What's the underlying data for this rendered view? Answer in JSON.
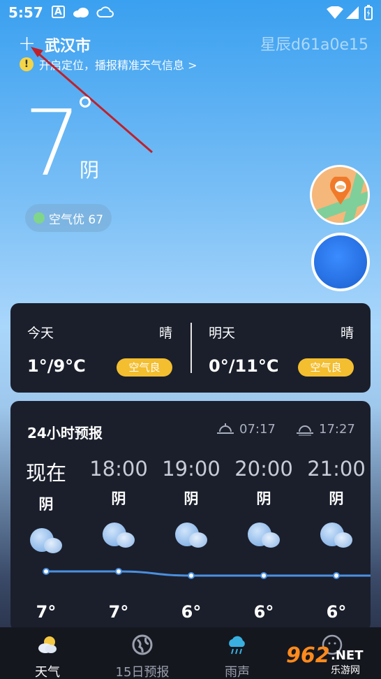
{
  "status": {
    "time": "5:57",
    "icons": [
      "a-notification-icon",
      "cloud-icon",
      "cloud-outline-icon",
      "wifi-icon",
      "signal-icon",
      "battery-icon"
    ]
  },
  "header": {
    "city": "武汉市",
    "watermark": "星辰d61a0e15",
    "location_hint": "开启定位，播报精准天气信息 >"
  },
  "current": {
    "temperature": "7",
    "condition": "阴",
    "aqi": "空气优 67"
  },
  "days": [
    {
      "name": "今天",
      "condition": "晴",
      "temp": "1°/9°C",
      "aqi": "空气良"
    },
    {
      "name": "明天",
      "condition": "晴",
      "temp": "0°/11°C",
      "aqi": "空气良"
    }
  ],
  "hourly": {
    "title": "24小时预报",
    "sunrise": "07:17",
    "sunset": "17:27",
    "hours": [
      {
        "time": "现在",
        "condition": "阴",
        "temp": "7°",
        "value": 7
      },
      {
        "time": "18:00",
        "condition": "阴",
        "temp": "7°",
        "value": 7
      },
      {
        "time": "19:00",
        "condition": "阴",
        "temp": "6°",
        "value": 6
      },
      {
        "time": "20:00",
        "condition": "阴",
        "temp": "6°",
        "value": 6
      },
      {
        "time": "21:00",
        "condition": "阴",
        "temp": "6°",
        "value": 6
      }
    ]
  },
  "tabs": [
    {
      "label": "天气",
      "icon": "weather-icon",
      "active": true
    },
    {
      "label": "15日预报",
      "icon": "globe-icon",
      "active": false
    },
    {
      "label": "雨声",
      "icon": "rain-cloud-icon",
      "active": false
    },
    {
      "label": "",
      "icon": "smile-icon",
      "active": false
    }
  ],
  "logo": "962.NET 乐游网",
  "colors": {
    "accent_yellow": "#f3be2f",
    "card_bg": "#1b1f2c",
    "arrow_red": "#c0202a"
  }
}
